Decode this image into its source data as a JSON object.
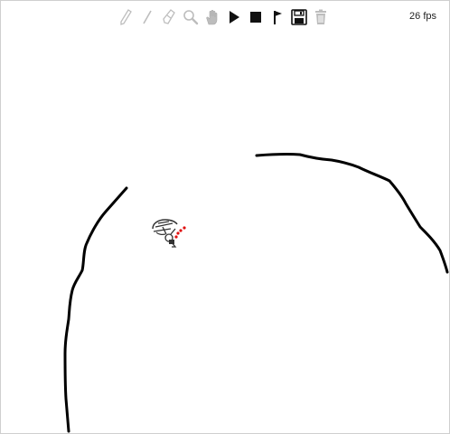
{
  "toolbar": {
    "tools": [
      {
        "icon": "pencil-icon",
        "state": "disabled"
      },
      {
        "icon": "line-icon",
        "state": "disabled"
      },
      {
        "icon": "eraser-icon",
        "state": "disabled"
      },
      {
        "icon": "magnifier-icon",
        "state": "disabled"
      },
      {
        "icon": "hand-icon",
        "state": "disabled"
      },
      {
        "icon": "play-icon",
        "state": "enabled"
      },
      {
        "icon": "stop-icon",
        "state": "enabled"
      },
      {
        "icon": "flag-icon",
        "state": "enabled"
      },
      {
        "icon": "save-icon",
        "state": "enabled"
      },
      {
        "icon": "trash-icon",
        "state": "disabled"
      }
    ]
  },
  "status": {
    "fps": "26 fps"
  },
  "colors": {
    "enabled": "#111111",
    "disabled": "#bdbdbd",
    "track": "#000000",
    "rider": "#333333",
    "trail": "#e01010"
  }
}
